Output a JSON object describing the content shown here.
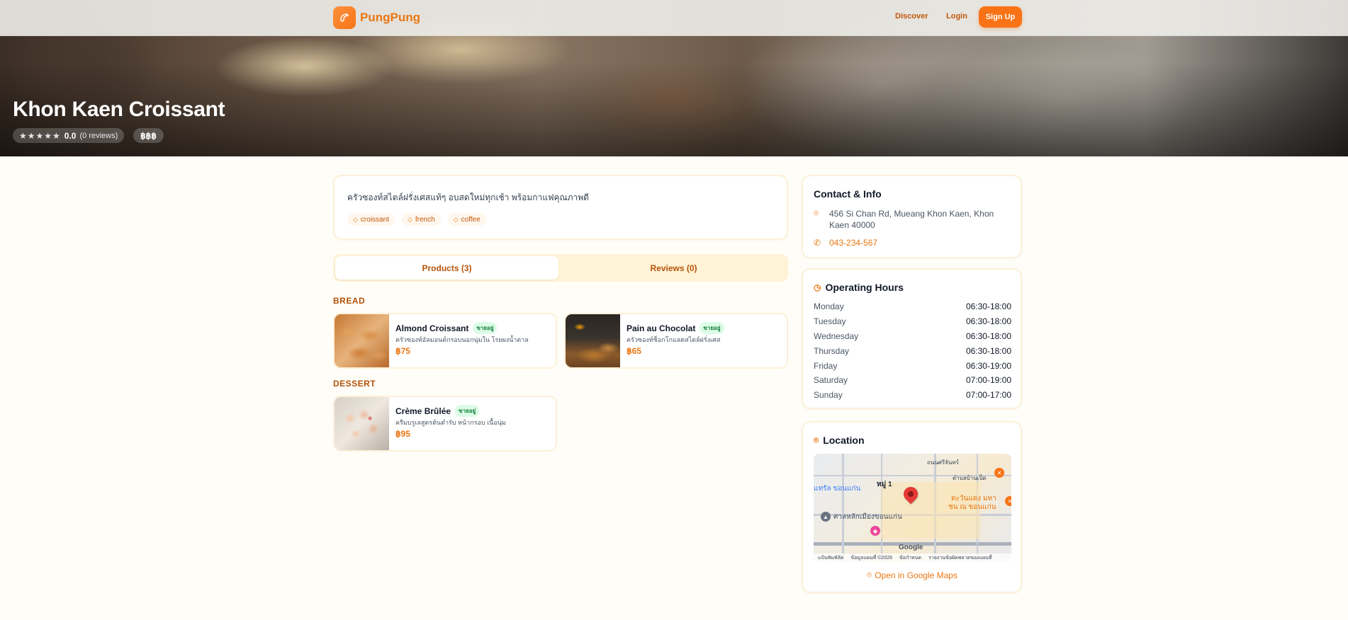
{
  "header": {
    "brand": "PungPung",
    "nav": {
      "discover": "Discover",
      "login": "Login",
      "signup": "Sign Up"
    }
  },
  "shop": {
    "name": "Khon Kaen Croissant",
    "rating": "0.0",
    "stars": "★★★★★",
    "reviews_count": "(0 reviews)",
    "price_level": "฿฿฿",
    "description": "ครัวซองท์สไตล์ฝรั่งเศสแท้ๆ อบสดใหม่ทุกเช้า พร้อมกาแฟคุณภาพดี",
    "tags": [
      "croissant",
      "french",
      "coffee"
    ]
  },
  "tabs": {
    "products": "Products (3)",
    "reviews": "Reviews (0)"
  },
  "sections": [
    {
      "label": "BREAD",
      "products": [
        {
          "name": "Almond Croissant",
          "badge": "ขายอยู่",
          "desc": "ครัวซองท์อัลมอนด์กรอบนอกนุ่มใน โรยผงน้ำตาล",
          "price": "฿75"
        },
        {
          "name": "Pain au Chocolat",
          "badge": "ขายอยู่",
          "desc": "ครัวซองท์ช็อกโกแลตสไตล์ฝรั่งเศส",
          "price": "฿65"
        }
      ]
    },
    {
      "label": "DESSERT",
      "products": [
        {
          "name": "Crème Brûlée",
          "badge": "ขายอยู่",
          "desc": "ครีมบรูเลสูตรต้นตำรับ หน้ากรอบ เนื้อนุ่ม",
          "price": "฿95"
        }
      ]
    }
  ],
  "contact": {
    "title": "Contact & Info",
    "address": "456 Si Chan Rd, Mueang Khon Kaen, Khon Kaen 40000",
    "phone": "043-234-567"
  },
  "hours": {
    "title": "Operating Hours",
    "rows": [
      {
        "day": "Monday",
        "time": "06:30-18:00"
      },
      {
        "day": "Tuesday",
        "time": "06:30-18:00"
      },
      {
        "day": "Wednesday",
        "time": "06:30-18:00"
      },
      {
        "day": "Thursday",
        "time": "06:30-18:00"
      },
      {
        "day": "Friday",
        "time": "06:30-19:00"
      },
      {
        "day": "Saturday",
        "time": "07:00-19:00"
      },
      {
        "day": "Sunday",
        "time": "07:00-17:00"
      }
    ]
  },
  "location": {
    "title": "Location",
    "open_maps": "Open in Google Maps",
    "map": {
      "labels": {
        "moo": "หมู่ 1",
        "west": "แทรัล ขอนแก่น",
        "shrine": "ศาลหลักเมืองขอนแก่น",
        "east1": "ตะวันแดง มหา",
        "east2": "ชน ณ ขอนแก่น",
        "road": "ถนนศรีจันทร์",
        "district": "ตำบลบ้านเป็ด"
      },
      "google": "Google",
      "footer": [
        "แป้นพิมพ์ลัด",
        "ข้อมูลแผนที่ ©2026",
        "ข้อกำหนด",
        "รายงานข้อผิดพลาดของแผนที่"
      ]
    }
  },
  "colors": {
    "accent": "#f97316",
    "accent_text": "#ea7612",
    "card_border": "#fdf0d8"
  }
}
